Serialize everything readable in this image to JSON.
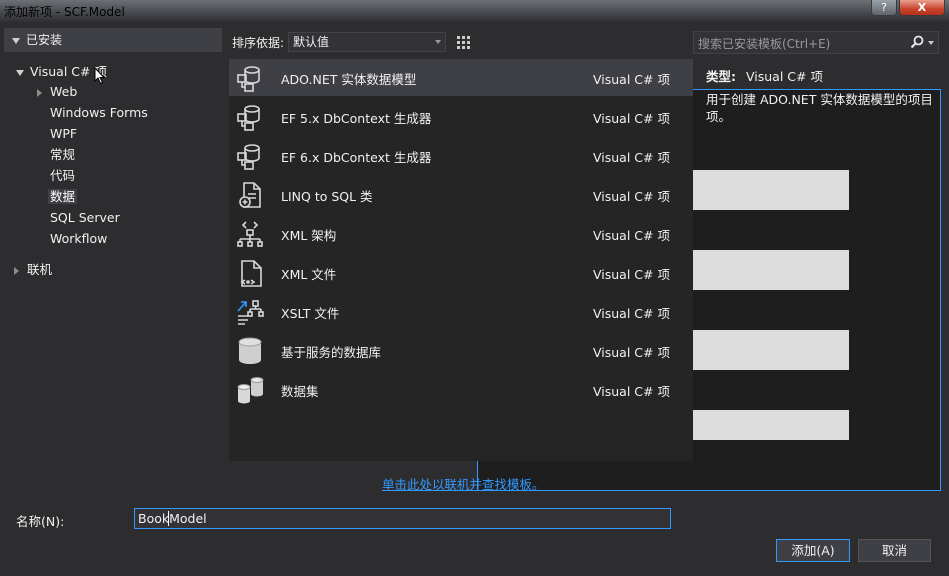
{
  "window": {
    "title": "添加新项 - SCF.Model",
    "help_label": "?",
    "close_label": "X"
  },
  "sidebar": {
    "header": "已安装",
    "root": "Visual C# 项",
    "items": [
      "Web",
      "Windows Forms",
      "WPF",
      "常规",
      "代码",
      "数据",
      "SQL Server",
      "Workflow"
    ],
    "selected": "数据",
    "online": "联机"
  },
  "sort": {
    "label": "排序依据:",
    "value": "默认值"
  },
  "search": {
    "placeholder": "搜索已安装模板(Ctrl+E)"
  },
  "templates": [
    {
      "name": "ADO.NET 实体数据模型",
      "lang": "Visual C# 项",
      "icon": "entity-model-icon"
    },
    {
      "name": "EF 5.x DbContext 生成器",
      "lang": "Visual C# 项",
      "icon": "entity-model-icon"
    },
    {
      "name": "EF 6.x DbContext 生成器",
      "lang": "Visual C# 项",
      "icon": "entity-model-icon"
    },
    {
      "name": "LINQ to SQL 类",
      "lang": "Visual C# 项",
      "icon": "linq-sql-icon"
    },
    {
      "name": "XML 架构",
      "lang": "Visual C# 项",
      "icon": "xml-schema-icon"
    },
    {
      "name": "XML 文件",
      "lang": "Visual C# 项",
      "icon": "xml-file-icon"
    },
    {
      "name": "XSLT 文件",
      "lang": "Visual C# 项",
      "icon": "xslt-file-icon"
    },
    {
      "name": "基于服务的数据库",
      "lang": "Visual C# 项",
      "icon": "database-icon"
    },
    {
      "name": "数据集",
      "lang": "Visual C# 项",
      "icon": "dataset-icon"
    }
  ],
  "online_link": "单击此处以联机并查找模板。",
  "details": {
    "type_label": "类型:",
    "type_value": "Visual C# 项",
    "description": "用于创建 ADO.NET 实体数据模型的项目项。"
  },
  "name_field": {
    "label": "名称(N):",
    "value": "BookModel"
  },
  "buttons": {
    "add": "添加(A)",
    "cancel": "取消"
  }
}
